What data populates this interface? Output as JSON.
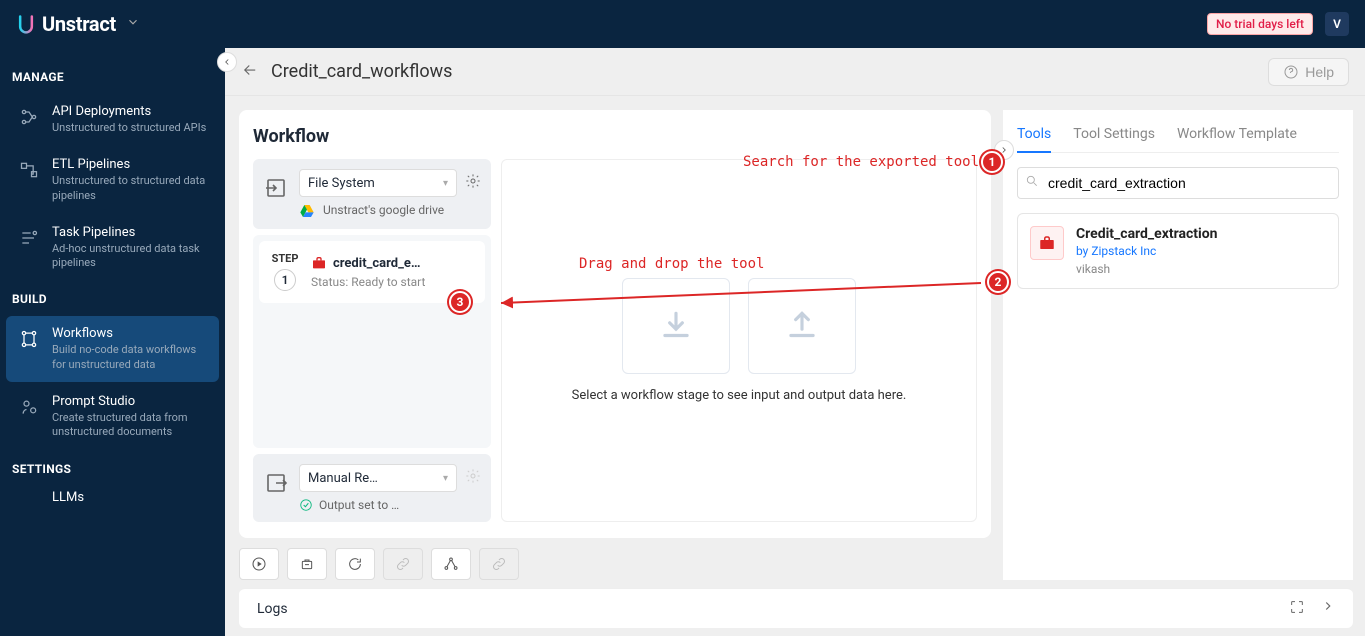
{
  "brand": "Unstract",
  "trial_badge": "No trial days left",
  "avatar": "V",
  "sidebar": {
    "sections": {
      "manage": "MANAGE",
      "build": "BUILD",
      "settings": "SETTINGS"
    },
    "items": [
      {
        "title": "API Deployments",
        "sub": "Unstructured to structured APIs"
      },
      {
        "title": "ETL Pipelines",
        "sub": "Unstructured to structured data pipelines"
      },
      {
        "title": "Task Pipelines",
        "sub": "Ad-hoc unstructured data task pipelines"
      },
      {
        "title": "Workflows",
        "sub": "Build no-code data workflows for unstructured data"
      },
      {
        "title": "Prompt Studio",
        "sub": "Create structured data from unstructured documents"
      },
      {
        "title": "LLMs",
        "sub": ""
      }
    ]
  },
  "header": {
    "title": "Credit_card_workflows",
    "help": "Help"
  },
  "workflow": {
    "heading": "Workflow",
    "input": {
      "type": "File System",
      "source": "Unstract's google drive"
    },
    "step": {
      "label": "STEP",
      "num": "1",
      "name": "credit_card_e…",
      "status": "Status: Ready to start"
    },
    "output": {
      "type": "Manual Re…",
      "status": "Output set to …"
    },
    "canvas_hint": "Select a workflow stage to see input and output data here."
  },
  "tools": {
    "tabs": [
      "Tools",
      "Tool Settings",
      "Workflow Template"
    ],
    "search_value": "credit_card_extraction",
    "result": {
      "name": "Credit_card_extraction",
      "by": "by Zipstack Inc",
      "user": "vikash"
    }
  },
  "logs": {
    "label": "Logs"
  },
  "annotations": {
    "a1": "Search for the exported tool ->",
    "a2": "Drag and drop the tool",
    "n1": "1",
    "n2": "2",
    "n3": "3"
  }
}
